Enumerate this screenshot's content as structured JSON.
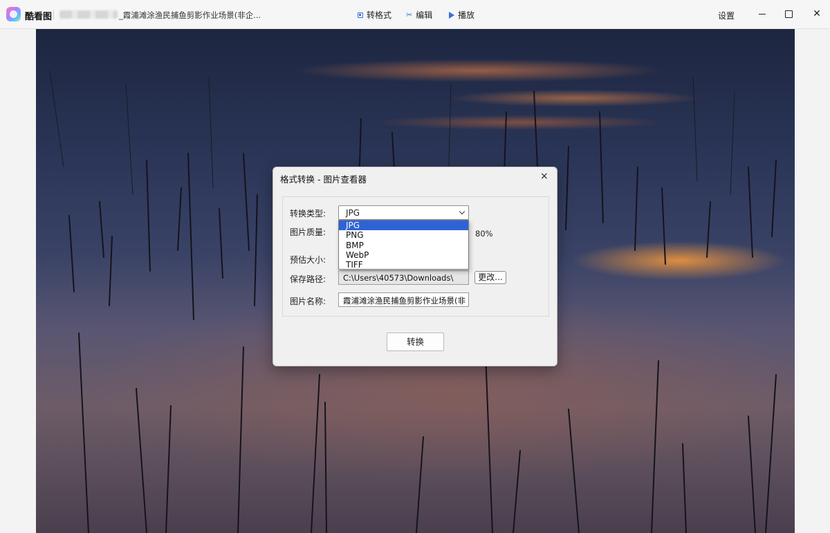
{
  "app": {
    "name": "酷看图",
    "file_title": "_霞浦滩涂渔民捕鱼剪影作业场景(非企..."
  },
  "toolbar": {
    "convert_label": "转格式",
    "edit_label": "编辑",
    "play_label": "播放"
  },
  "window": {
    "settings_label": "设置"
  },
  "dialog": {
    "title": "格式转换 - 图片查看器",
    "close": "×",
    "type_label": "转换类型:",
    "type_value": "JPG",
    "type_options": [
      "JPG",
      "PNG",
      "BMP",
      "WebP",
      "TIFF"
    ],
    "quality_label": "图片质量:",
    "quality_value": "80%",
    "size_label": "预估大小:",
    "path_label": "保存路径:",
    "path_value": "C:\\Users\\40573\\Downloads\\",
    "change_button": "更改...",
    "name_label": "图片名称:",
    "name_value": "霞浦滩涂渔民捕鱼剪影作业场景(非",
    "convert_button": "转换"
  },
  "colors": {
    "accent": "#3a6fd8",
    "selection": "#2e63d6"
  }
}
